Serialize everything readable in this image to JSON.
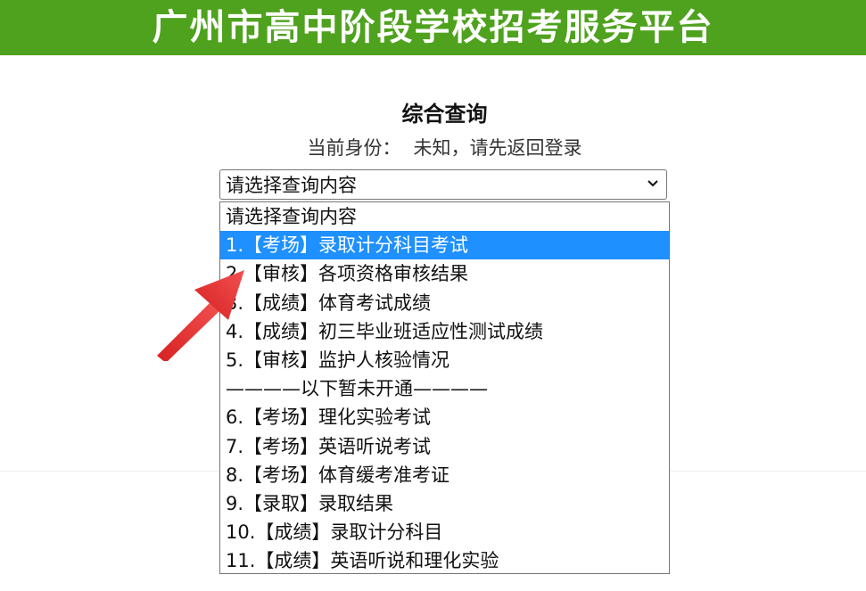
{
  "header": {
    "title": "广州市高中阶段学校招考服务平台",
    "bg_color": "#4ea21d"
  },
  "page": {
    "title": "综合查询",
    "identity_label": "当前身份：",
    "identity_value": "未知，请先返回登录"
  },
  "select": {
    "current_value": "请选择查询内容",
    "icon": "chevron-down-icon"
  },
  "dropdown": {
    "options": [
      "请选择查询内容",
      "1.【考场】录取计分科目考试",
      "2.【审核】各项资格审核结果",
      "3.【成绩】体育考试成绩",
      "4.【成绩】初三毕业班适应性测试成绩",
      "5.【审核】监护人核验情况",
      "————以下暂未开通————",
      "6.【考场】理化实验考试",
      "7.【考场】英语听说考试",
      "8.【考场】体育缓考准考证",
      "9.【录取】录取结果",
      "10.【成绩】录取计分科目",
      "11.【成绩】英语听说和理化实验"
    ],
    "highlighted_index": 1,
    "highlight_color": "#1e90ff"
  },
  "annotation": {
    "icon": "red-arrow-icon",
    "color": "#e83a3a"
  }
}
